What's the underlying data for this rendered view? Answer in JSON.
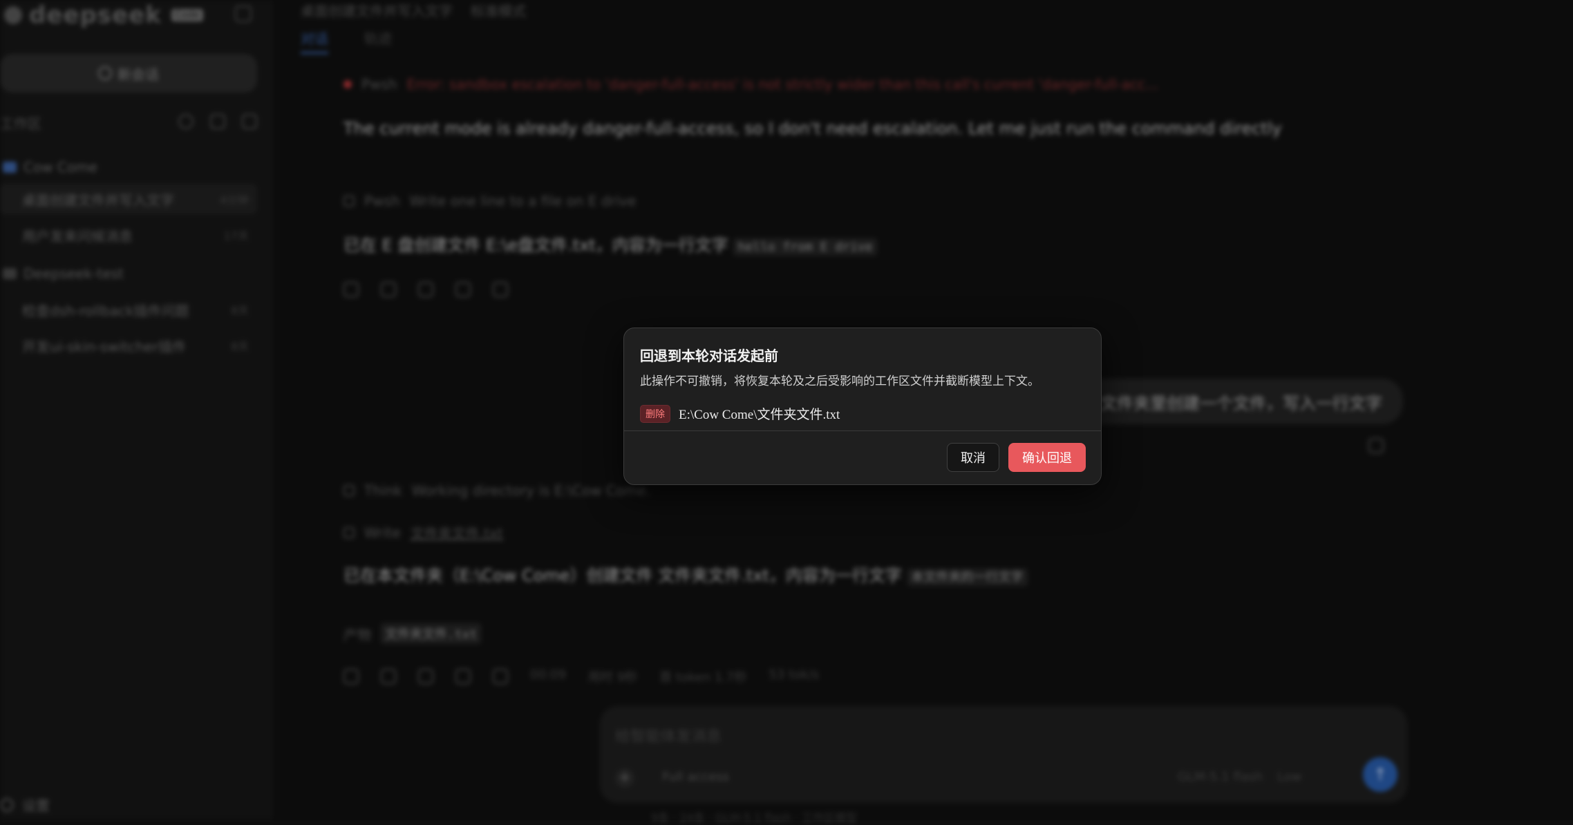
{
  "sidebar": {
    "logo_text": "deepseek",
    "logo_badge": "Code",
    "new_chat_label": "新会话",
    "workspace_label": "工作区",
    "projects": [
      {
        "name": "Cow Come",
        "sessions": [
          {
            "title": "桌面创建文件并写入文字",
            "meta": "4分钟"
          },
          {
            "title": "用户发来问候消息",
            "meta": "17天"
          }
        ]
      },
      {
        "name": "Deepseek-test",
        "sessions": [
          {
            "title": "检查dsh-rollback插件问题",
            "meta": "8天"
          },
          {
            "title": "开发ui-skin-switcher插件",
            "meta": "8天"
          }
        ]
      }
    ],
    "settings_label": "设置"
  },
  "topbar": {
    "title": "桌面创建文件并写入文字",
    "mode": "标准模式"
  },
  "tabs": [
    "对话",
    "轨迹"
  ],
  "conversation": {
    "tool_error_name": "Pwsh",
    "tool_error_text": "Error: sandbox escalation to 'danger-full-access' is not strictly wider than this call's current 'danger-full-acc...",
    "reply_1": "The current mode is already danger-full-access, so I don't need escalation. Let me just run the command directly",
    "tool_2_name": "Pwsh",
    "tool_2_text": "Write one line to a file on E drive",
    "reply_2_prefix": "已在 E 盘创建文件 E:\\e盘文件.txt，内容为一行文字",
    "reply_2_code": "hello from E drive",
    "user_msg": "文件夹里创建一个文件，写入一行文字",
    "think_name": "Think",
    "think_text": "Working directory is E:\\Cow Come.",
    "write_name": "Write",
    "write_file": "文件夹文件.txt",
    "reply_3_prefix": "已在本文件夹（E:\\Cow Come）创建文件 文件夹文件.txt，内容为一行文字",
    "reply_3_code": "本文件夹的一行文字",
    "artifact_label": "产物",
    "artifact_file": "文件夹文件.txt",
    "stats": [
      "00:09",
      "用时 9秒",
      "首 token 1.7秒",
      "53 tok/s"
    ]
  },
  "composer": {
    "placeholder": "给智能体发消息",
    "access": "Full access",
    "model": "GLM-5.1 flash",
    "effort": "Low",
    "footer": "9条 · 24条 · GLM-5.1 flash · 工作区模型"
  },
  "dialog": {
    "title": "回退到本轮对话发起前",
    "description": "此操作不可撤销，将恢复本轮及之后受影响的工作区文件并截断模型上下文。",
    "badge": "删除",
    "path": "E:\\Cow Come\\文件夹文件.txt",
    "cancel_label": "取消",
    "confirm_label": "确认回退",
    "colors": {
      "confirm": "#e8585c",
      "badge": "#ff7d7d"
    }
  }
}
